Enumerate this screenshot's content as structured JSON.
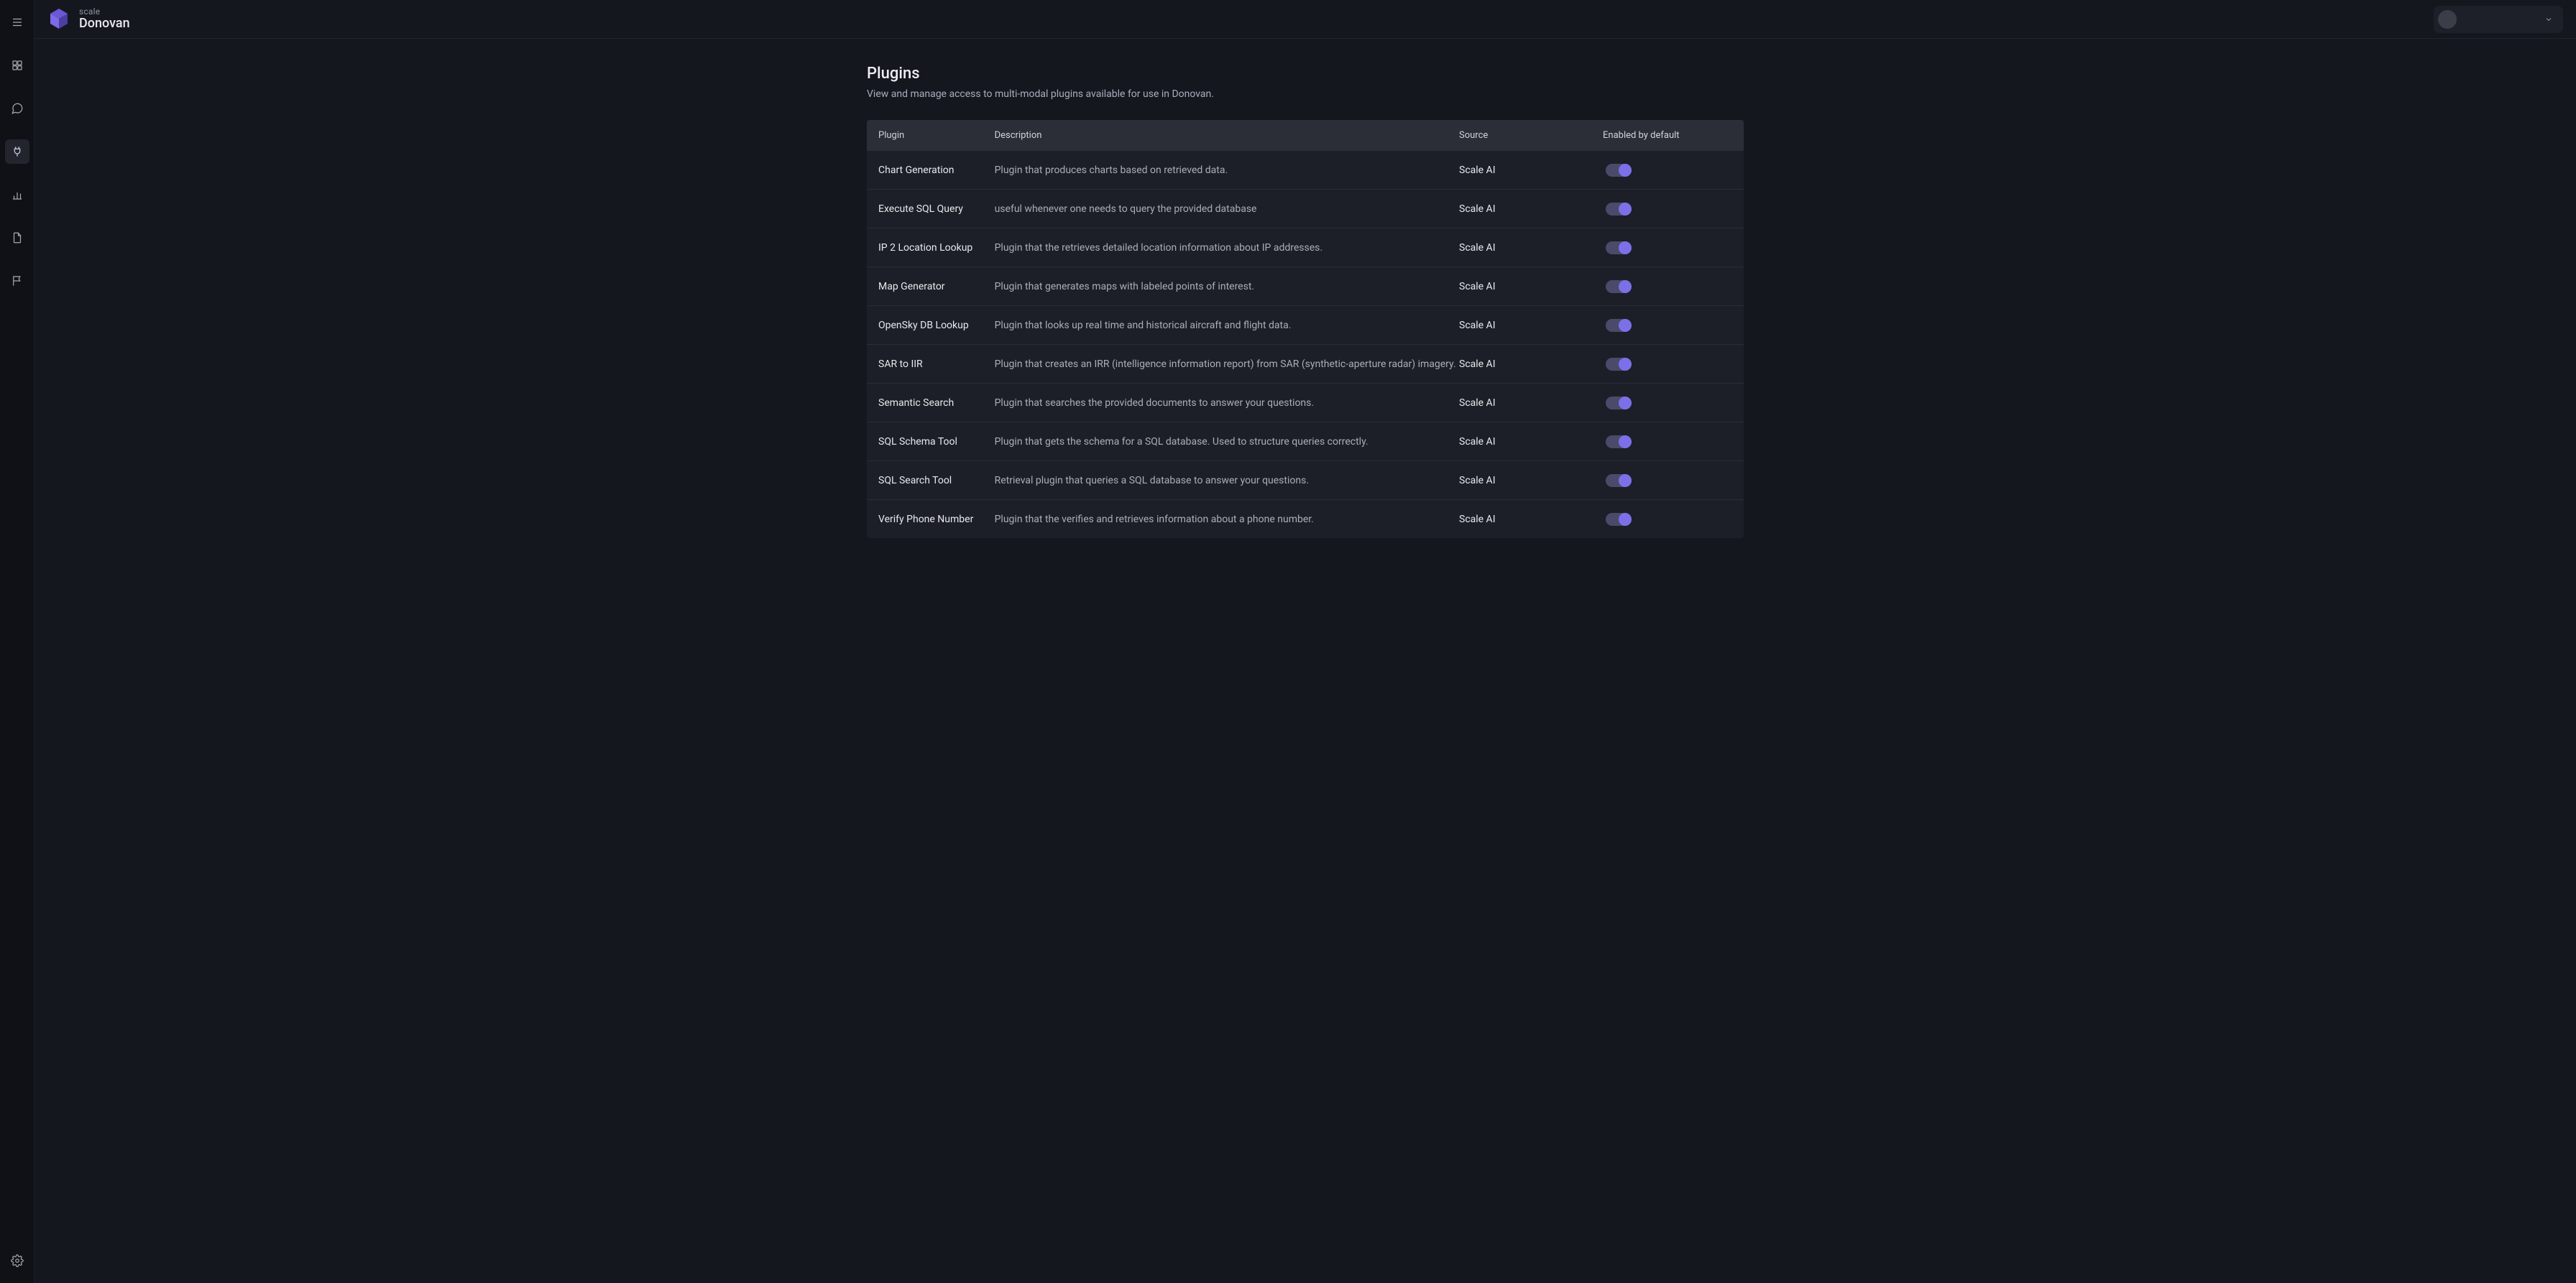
{
  "brand": {
    "sub": "scale",
    "main": "Donovan"
  },
  "page": {
    "title": "Plugins",
    "description": "View and manage access to multi-modal plugins available for use in Donovan."
  },
  "columns": {
    "plugin": "Plugin",
    "description": "Description",
    "source": "Source",
    "enabled": "Enabled by default"
  },
  "rows": [
    {
      "name": "Chart Generation",
      "desc": "Plugin that produces charts based on retrieved data.",
      "source": "Scale AI",
      "enabled": true
    },
    {
      "name": "Execute SQL Query",
      "desc": "useful whenever one needs to query the provided database",
      "source": "Scale AI",
      "enabled": true
    },
    {
      "name": "IP 2 Location Lookup",
      "desc": "Plugin that the retrieves detailed location information about IP addresses.",
      "source": "Scale AI",
      "enabled": true
    },
    {
      "name": "Map Generator",
      "desc": "Plugin that generates maps with labeled points of interest.",
      "source": "Scale AI",
      "enabled": true
    },
    {
      "name": "OpenSky DB Lookup",
      "desc": "Plugin that looks up real time and historical aircraft and flight data.",
      "source": "Scale AI",
      "enabled": true
    },
    {
      "name": "SAR to IIR",
      "desc": "Plugin that creates an IRR (intelligence information report) from SAR (synthetic-aperture radar) imagery.",
      "source": "Scale AI",
      "enabled": true
    },
    {
      "name": "Semantic Search",
      "desc": "Plugin that searches the provided documents to answer your questions.",
      "source": "Scale AI",
      "enabled": true
    },
    {
      "name": "SQL Schema Tool",
      "desc": "Plugin that gets the schema for a SQL database. Used to structure queries correctly.",
      "source": "Scale AI",
      "enabled": true
    },
    {
      "name": "SQL Search Tool",
      "desc": "Retrieval plugin that queries a SQL database to answer your questions.",
      "source": "Scale AI",
      "enabled": true
    },
    {
      "name": "Verify Phone Number",
      "desc": "Plugin that the verifies and retrieves information about a phone number.",
      "source": "Scale AI",
      "enabled": true
    }
  ]
}
